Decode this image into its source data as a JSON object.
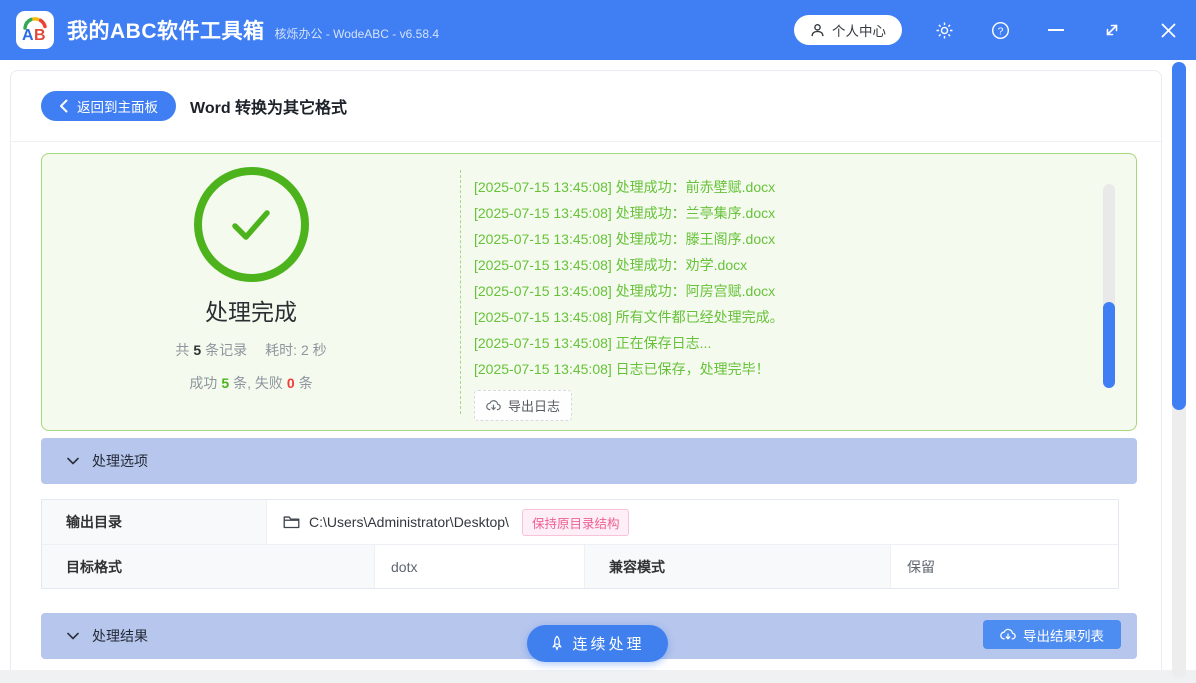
{
  "titlebar": {
    "app_title": "我的ABC软件工具箱",
    "app_subtitle": "核烁办公 - WodeABC - v6.58.4",
    "user_center_label": "个人中心"
  },
  "toolbar": {
    "back_label": "返回到主面板",
    "page_title": "Word 转换为其它格式"
  },
  "result_panel": {
    "status_title": "处理完成",
    "records": {
      "prefix": "共",
      "count": "5",
      "suffix": "条记录"
    },
    "elapsed": {
      "label": "耗时:",
      "value": "2 秒"
    },
    "success": {
      "label": "成功",
      "count": "5",
      "suffix": "条,"
    },
    "fail": {
      "label": "失败",
      "count": "0",
      "suffix": "条"
    },
    "logs": [
      "[2025-07-15 13:45:08] 处理成功：前赤壁赋.docx",
      "[2025-07-15 13:45:08] 处理成功：兰亭集序.docx",
      "[2025-07-15 13:45:08] 处理成功：滕王阁序.docx",
      "[2025-07-15 13:45:08] 处理成功：劝学.docx",
      "[2025-07-15 13:45:08] 处理成功：阿房宫赋.docx",
      "[2025-07-15 13:45:08] 所有文件都已经处理完成。",
      "[2025-07-15 13:45:08] 正在保存日志...",
      "[2025-07-15 13:45:08] 日志已保存，处理完毕！"
    ],
    "export_log_label": "导出日志"
  },
  "sections": {
    "options_header": "处理选项",
    "results_header": "处理结果"
  },
  "options": {
    "output_dir_label": "输出目录",
    "output_dir_value": "C:\\Users\\Administrator\\Desktop\\",
    "keep_structure_tag": "保持原目录结构",
    "target_format_label": "目标格式",
    "target_format_value": "dotx",
    "compat_mode_label": "兼容模式",
    "compat_mode_value": "保留"
  },
  "actions": {
    "continue_label": "连续处理",
    "export_results_label": "导出结果列表"
  },
  "icons": {
    "titlebar": [
      "app-logo",
      "user-icon",
      "settings-gear-icon",
      "help-icon",
      "minimize-icon",
      "resize-icon",
      "close-icon"
    ],
    "content": [
      "back-chevron-icon",
      "check-circle-icon",
      "download-cloud-icon",
      "chevron-down-icon",
      "folder-icon",
      "rocket-icon"
    ]
  },
  "colors": {
    "primary_blue": "#3f7ef3",
    "section_header_bg": "#b7c6ec",
    "success_green": "#4db31d",
    "log_green": "#67c23a",
    "panel_bg": "#f4fbee",
    "panel_border": "#a3d87c",
    "fail_red": "#f23c3c",
    "tag_pink": "#ee5f93"
  }
}
